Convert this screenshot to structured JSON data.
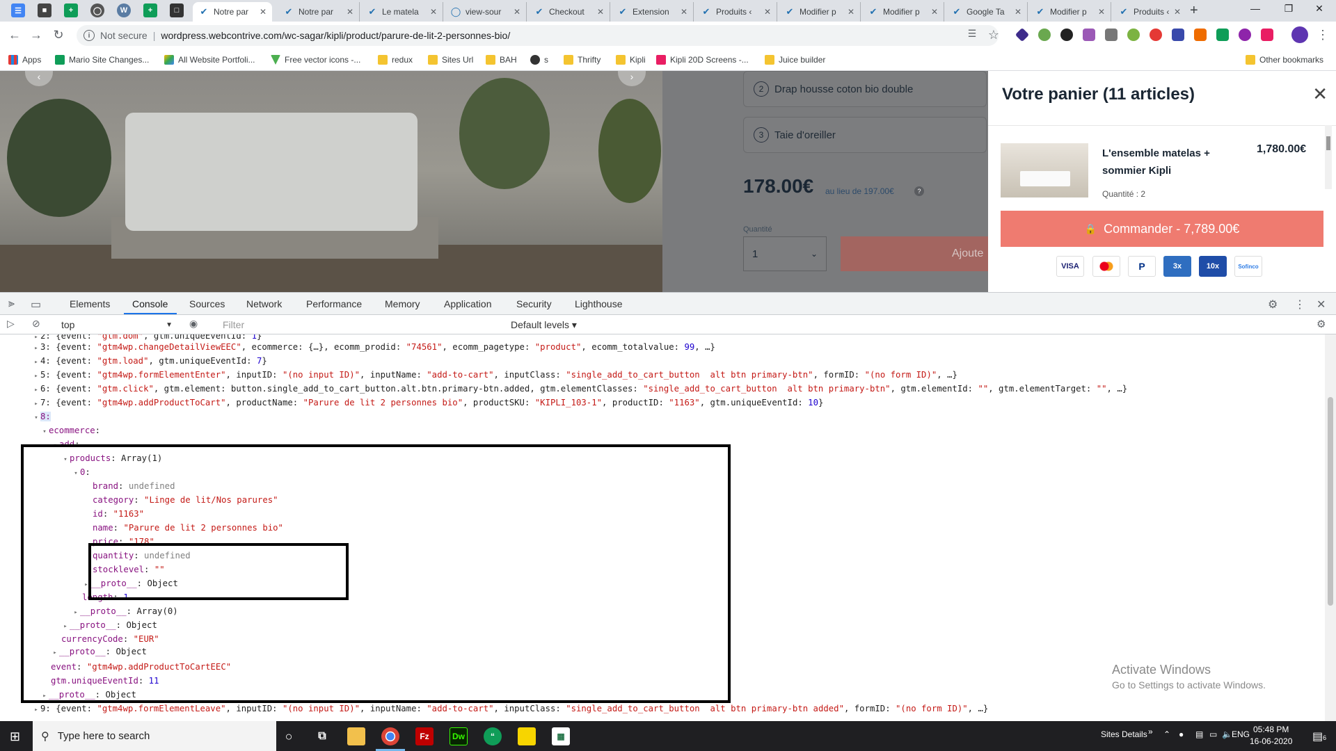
{
  "browser": {
    "tabs": [
      {
        "label": "Notre par"
      },
      {
        "label": "Notre par"
      },
      {
        "label": "Le matela"
      },
      {
        "label": "view-sour"
      },
      {
        "label": "Checkout"
      },
      {
        "label": "Extension"
      },
      {
        "label": "Produits ‹"
      },
      {
        "label": "Modifier p"
      },
      {
        "label": "Modifier p"
      },
      {
        "label": "Google Ta"
      },
      {
        "label": "Modifier p"
      },
      {
        "label": "Produits ‹"
      }
    ],
    "security_label": "Not secure",
    "url": "wordpress.webcontrive.com/wc-sagar/kipli/product/parure-de-lit-2-personnes-bio/",
    "bookmarks": [
      {
        "label": "Apps"
      },
      {
        "label": "Mario Site Changes..."
      },
      {
        "label": "All Website Portfoli..."
      },
      {
        "label": "Free vector icons -..."
      },
      {
        "label": "redux"
      },
      {
        "label": "Sites Url"
      },
      {
        "label": "BAH"
      },
      {
        "label": "s"
      },
      {
        "label": "Thrifty"
      },
      {
        "label": "Kipli"
      },
      {
        "label": "Kipli 20D Screens -..."
      },
      {
        "label": "Juice builder"
      },
      {
        "label": "Other bookmarks"
      }
    ]
  },
  "product": {
    "options": [
      {
        "num": "2",
        "label": "Drap housse coton bio double"
      },
      {
        "num": "3",
        "label": "Taie d'oreiller"
      }
    ],
    "price": "178.00€",
    "old_price": "au lieu de 197.00€",
    "help_mark": "?",
    "qty_label": "Quantité",
    "qty_value": "1",
    "add_label": "Ajoute"
  },
  "cart": {
    "title": "Votre panier (11 articles)",
    "item_name": "L'ensemble matelas + sommier Kipli",
    "item_price": "1,780.00€",
    "item_qty": "Quantité : 2",
    "checkout_label": "Commander - 7,789.00€",
    "payments": [
      "VISA",
      "",
      "",
      "3x",
      "10x",
      "Sofinco"
    ]
  },
  "devtools": {
    "tabs": [
      "Elements",
      "Console",
      "Sources",
      "Network",
      "Performance",
      "Memory",
      "Application",
      "Security",
      "Lighthouse"
    ],
    "context": "top",
    "filter_placeholder": "Filter",
    "levels": "Default levels ▾"
  },
  "windows": {
    "activate_title": "Activate Windows",
    "activate_sub": "Go to Settings to activate Windows.",
    "search_placeholder": "Type here to search",
    "sites_details": "Sites Details",
    "lang": "ENG",
    "time": "05:48 PM",
    "date": "16-06-2020",
    "notif_count": "6"
  }
}
